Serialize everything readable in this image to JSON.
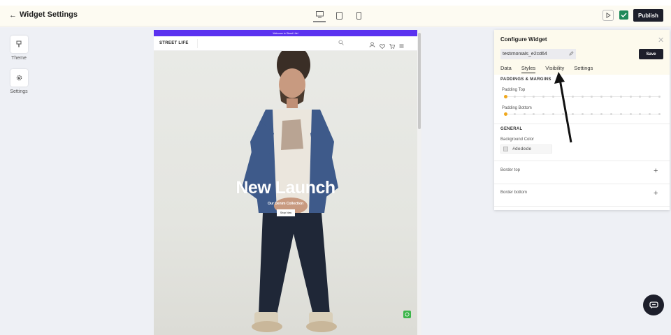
{
  "header": {
    "back_label": "←",
    "title": "Widget Settings",
    "publish_label": "Publish"
  },
  "sidebar": {
    "items": [
      {
        "label": "Theme",
        "icon": "brush-icon"
      },
      {
        "label": "Settings",
        "icon": "gear-icon"
      }
    ]
  },
  "preview": {
    "announcement": "Welcome to Street Life!",
    "logo": "STREET LIFE",
    "signin": "Sign in",
    "hero_title": "New Launch",
    "hero_subtitle": "Our Denim Collection",
    "cta": "Shop Now"
  },
  "config": {
    "title": "Configure Widget",
    "widget_name": "testimonials_e2cd64",
    "save_label": "Save",
    "tabs": [
      "Data",
      "Styles",
      "Visibility",
      "Settings"
    ],
    "active_tab": "Styles",
    "paddings_heading": "PADDINGS & MARGINS",
    "padding_top_label": "Padding Top",
    "padding_bottom_label": "Padding Bottom",
    "padding_top_value": 0,
    "padding_bottom_value": 0,
    "general_heading": "GENERAL",
    "bg_color_label": "Background Color",
    "bg_color_value": "#dedede",
    "border_top_label": "Border top",
    "border_bottom_label": "Border bottom"
  },
  "colors": {
    "accent_purple": "#5b32f0",
    "dark_button": "#1d1f2b",
    "check_green": "#1f8a5a",
    "slider_orange": "#f0a81d"
  }
}
